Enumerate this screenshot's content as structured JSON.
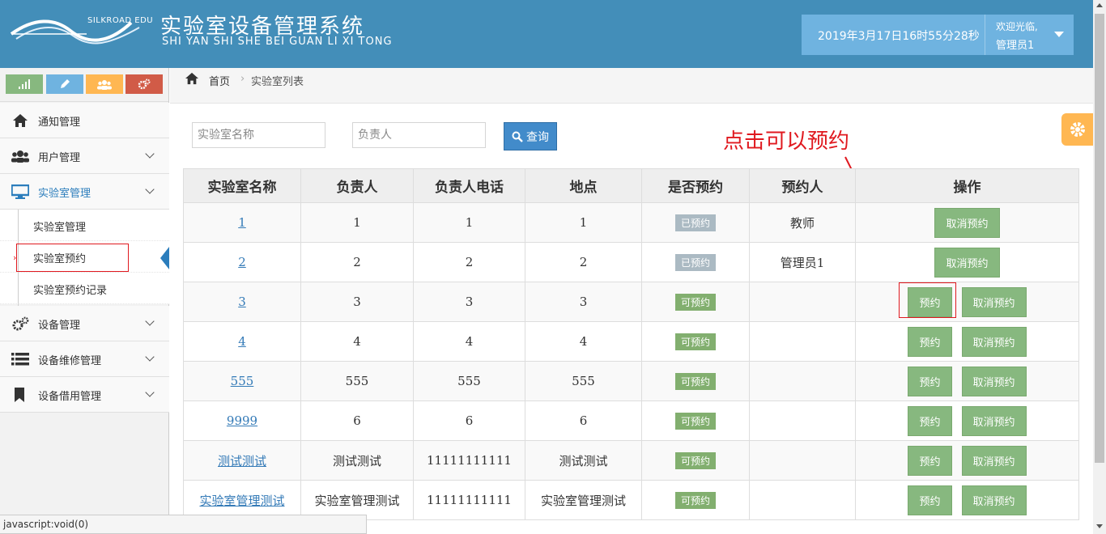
{
  "header": {
    "logo_text": "SILKROAD EDU",
    "title": "实验室设备管理系统",
    "subtitle": "SHI YAN SHI SHE BEI GUAN LI XI TONG",
    "datetime": "2019年3月17日16时55分28秒",
    "welcome": "欢迎光临,",
    "username": "管理员1"
  },
  "colors": {
    "header_bg": "#438eb9",
    "userbox_bg": "#6fb3e0",
    "accent": "#2b7dbc",
    "shortcut_colors": [
      "#87b87f",
      "#6fb3e0",
      "#ffb752",
      "#d15b47"
    ],
    "annotation": "#e0191f"
  },
  "shortcuts": [
    {
      "icon": "signal-icon"
    },
    {
      "icon": "pencil-icon"
    },
    {
      "icon": "group-icon"
    },
    {
      "icon": "cogs-icon"
    }
  ],
  "sidebar": {
    "items": [
      {
        "label": "通知管理",
        "icon": "home-icon"
      },
      {
        "label": "用户管理",
        "icon": "users-icon"
      },
      {
        "label": "实验室管理",
        "icon": "monitor-icon"
      },
      {
        "label": "设备管理",
        "icon": "cogs-icon"
      },
      {
        "label": "设备维修管理",
        "icon": "list-icon"
      },
      {
        "label": "设备借用管理",
        "icon": "bookmark-icon"
      }
    ],
    "sub_items": [
      {
        "label": "实验室管理"
      },
      {
        "label": "实验室预约"
      },
      {
        "label": "实验室预约记录"
      }
    ]
  },
  "breadcrumb": {
    "home": "首页",
    "current": "实验室列表"
  },
  "search": {
    "name_placeholder": "实验室名称",
    "owner_placeholder": "负责人",
    "query_label": "查询"
  },
  "annotation": "点击可以预约",
  "table": {
    "headers": [
      "实验室名称",
      "负责人",
      "负责人电话",
      "地点",
      "是否预约",
      "预约人",
      "操作"
    ],
    "rows": [
      {
        "name": "1",
        "owner": "1",
        "phone": "1",
        "location": "1",
        "status": "已预约",
        "reserver": "教师"
      },
      {
        "name": "2",
        "owner": "2",
        "phone": "2",
        "location": "2",
        "status": "已预约",
        "reserver": "管理员1"
      },
      {
        "name": "3",
        "owner": "3",
        "phone": "3",
        "location": "3",
        "status": "可预约",
        "reserver": ""
      },
      {
        "name": "4",
        "owner": "4",
        "phone": "4",
        "location": "4",
        "status": "可预约",
        "reserver": ""
      },
      {
        "name": "555",
        "owner": "555",
        "phone": "555",
        "location": "555",
        "status": "可预约",
        "reserver": ""
      },
      {
        "name": "9999",
        "owner": "6",
        "phone": "6",
        "location": "6",
        "status": "可预约",
        "reserver": ""
      },
      {
        "name": "测试测试",
        "owner": "测试测试",
        "phone": "11111111111",
        "location": "测试测试",
        "status": "可预约",
        "reserver": ""
      },
      {
        "name": "实验室管理测试",
        "owner": "实验室管理测试",
        "phone": "11111111111",
        "location": "实验室管理测试",
        "status": "可预约",
        "reserver": ""
      }
    ],
    "reserve_label": "预约",
    "cancel_label": "取消预约"
  },
  "statusbar": "javascript:void(0)"
}
